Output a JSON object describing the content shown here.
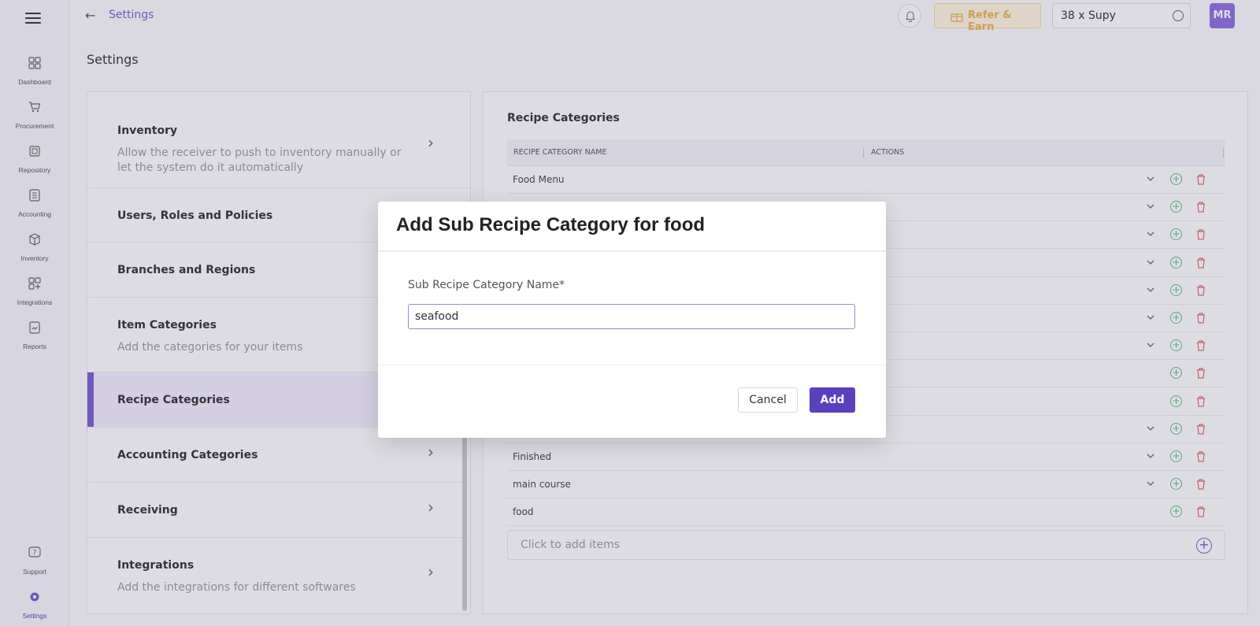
{
  "sidebar": {
    "items": [
      {
        "label": "Dashboard",
        "icon": "dashboard-icon"
      },
      {
        "label": "Procurement",
        "icon": "cart-icon"
      },
      {
        "label": "Repository",
        "icon": "repository-icon"
      },
      {
        "label": "Accounting",
        "icon": "accounting-icon"
      },
      {
        "label": "Inventory",
        "icon": "box-icon"
      },
      {
        "label": "Integrations",
        "icon": "integrations-icon"
      },
      {
        "label": "Reports",
        "icon": "reports-icon"
      }
    ],
    "bottom": [
      {
        "label": "Support",
        "icon": "help-icon"
      },
      {
        "label": "Settings",
        "icon": "gear-icon"
      }
    ]
  },
  "header": {
    "breadcrumb": "Settings",
    "refer_label": "Refer & Earn",
    "org_name": "38 x Supy",
    "avatar_initials": "MR"
  },
  "page": {
    "title": "Settings"
  },
  "settings_list": [
    {
      "title": "Inventory",
      "desc": "Allow the receiver to push to inventory manually or let the system do it automatically"
    },
    {
      "title": "Users, Roles and Policies",
      "desc": ""
    },
    {
      "title": "Branches and Regions",
      "desc": ""
    },
    {
      "title": "Item Categories",
      "desc": "Add the categories for your items"
    },
    {
      "title": "Recipe Categories",
      "desc": ""
    },
    {
      "title": "Accounting Categories",
      "desc": ""
    },
    {
      "title": "Receiving",
      "desc": ""
    },
    {
      "title": "Integrations",
      "desc": "Add the integrations for different softwares"
    }
  ],
  "recipe_panel": {
    "title": "Recipe Categories",
    "col_name": "RECIPE CATEGORY NAME",
    "col_actions": "ACTIONS",
    "rows": [
      "Food Menu",
      "",
      "",
      "",
      "",
      "",
      "",
      "",
      "",
      "",
      "Finished",
      "main course",
      "food"
    ],
    "add_items_label": "Click to add items"
  },
  "modal": {
    "title": "Add Sub Recipe Category for food",
    "field_label": "Sub Recipe Category Name*",
    "field_value": "seafood",
    "cancel_label": "Cancel",
    "add_label": "Add"
  },
  "colors": {
    "accent": "#5a3fbf",
    "accent_light": "#7b5fd0",
    "success": "#5bbf85",
    "danger": "#e06a6a"
  }
}
